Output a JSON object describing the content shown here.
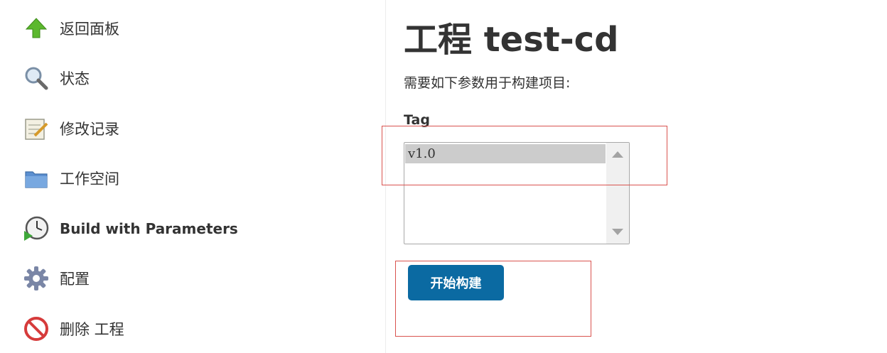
{
  "sidebar": {
    "items": [
      {
        "label": "返回面板",
        "icon": "up-arrow-icon"
      },
      {
        "label": "状态",
        "icon": "magnifier-icon"
      },
      {
        "label": "修改记录",
        "icon": "notepad-icon"
      },
      {
        "label": "工作空间",
        "icon": "folder-icon"
      },
      {
        "label": "Build with Parameters",
        "icon": "clock-play-icon"
      },
      {
        "label": "配置",
        "icon": "gear-icon"
      },
      {
        "label": "删除 工程",
        "icon": "no-entry-icon"
      }
    ]
  },
  "main": {
    "title": "工程 test-cd",
    "description": "需要如下参数用于构建项目:",
    "parameter": {
      "name": "Tag",
      "options": [
        "v1.0"
      ],
      "selected": "v1.0"
    },
    "build_button": "开始构建"
  },
  "colors": {
    "button": "#0b6aa2",
    "highlight_border": "#d9534f",
    "selected_option_bg": "#cccccc"
  }
}
